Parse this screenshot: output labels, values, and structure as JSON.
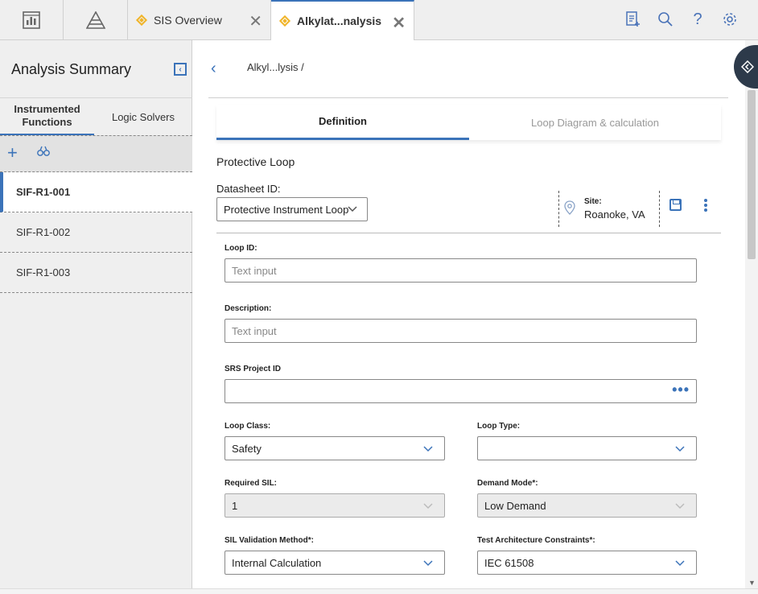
{
  "top_tabs": {
    "tab1_label": "SIS Overview",
    "tab2_label": "Alkylat...nalysis"
  },
  "top_icons": [
    "report-add-icon",
    "search-icon",
    "help-icon",
    "settings-icon"
  ],
  "sidebar": {
    "title": "Analysis Summary",
    "subtabs": [
      "Instrumented Functions",
      "Logic Solvers"
    ],
    "items": [
      "SIF-R1-001",
      "SIF-R1-002",
      "SIF-R1-003"
    ],
    "active_index": 0
  },
  "header": {
    "breadcrumb": "Alkyl...lysis /"
  },
  "main_tabs": {
    "definition": "Definition",
    "loop_diagram": "Loop Diagram & calculation"
  },
  "form": {
    "section_title": "Protective Loop",
    "datasheet_label": "Datasheet ID:",
    "datasheet_value": "Protective Instrument Loop",
    "site_label": "Site:",
    "site_value": "Roanoke, VA",
    "loop_id_label": "Loop ID:",
    "loop_id_placeholder": "Text input",
    "description_label": "Description:",
    "description_placeholder": "Text input",
    "srs_label": "SRS Project ID",
    "srs_value": "",
    "loop_class_label": "Loop Class:",
    "loop_class_value": "Safety",
    "loop_type_label": "Loop Type:",
    "loop_type_value": "",
    "required_sil_label": "Required SIL:",
    "required_sil_value": "1",
    "demand_mode_label": "Demand Mode*:",
    "demand_mode_value": "Low Demand",
    "sil_validation_label": "SIL Validation Method*:",
    "sil_validation_value": "Internal Calculation",
    "test_arch_label": "Test Architecture Constraints*:",
    "test_arch_value": "IEC 61508"
  },
  "colors": {
    "accent": "#3b73b9",
    "tab_icon": "#f0b429",
    "sidebar_bg": "#efefef"
  }
}
